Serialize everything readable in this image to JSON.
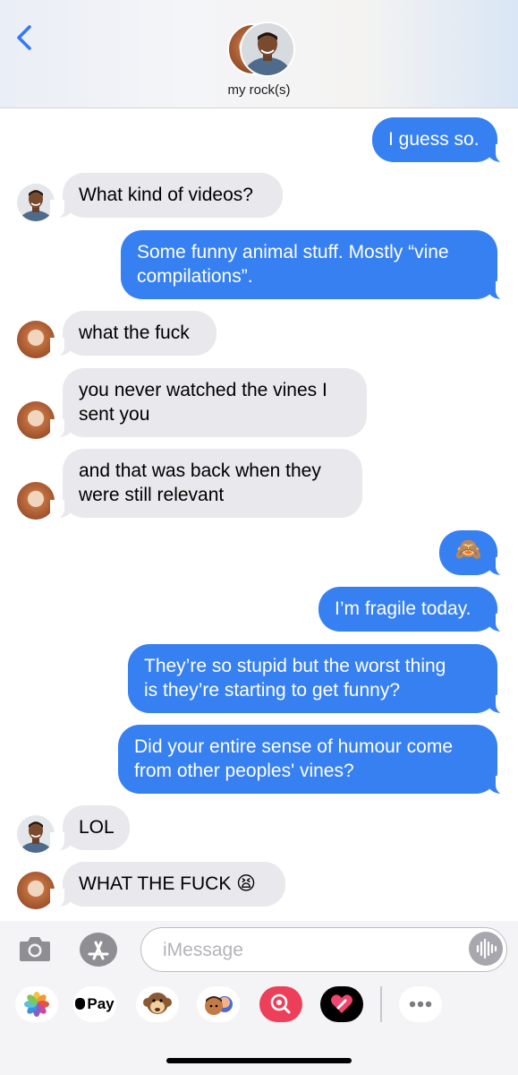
{
  "header": {
    "contact_name": "my rock(s)",
    "back_icon": "chevron-left-icon"
  },
  "messages": [
    {
      "from": "me",
      "text": "I guess so."
    },
    {
      "from": "man",
      "text": "What kind of videos?"
    },
    {
      "from": "me",
      "text": "Some funny animal stuff. Mostly “vine\ncompilations”."
    },
    {
      "from": "woman",
      "text": "what the fuck"
    },
    {
      "from": "woman",
      "text": "you never watched the vines I\nsent you"
    },
    {
      "from": "woman",
      "text": "and that was back when they\nwere still relevant"
    },
    {
      "from": "me",
      "text": "🙈"
    },
    {
      "from": "me",
      "text": "I’m fragile today."
    },
    {
      "from": "me",
      "text": "They’re so stupid but the worst thing\nis they’re starting to get funny?"
    },
    {
      "from": "me",
      "text": "Did your entire sense of humour come\nfrom other peoples' vines?"
    },
    {
      "from": "man",
      "text": "LOL"
    },
    {
      "from": "woman",
      "text": "WHAT THE FUCK 😫"
    }
  ],
  "input": {
    "placeholder": "iMessage",
    "value": ""
  },
  "app_drawer": {
    "apple_pay_label": "Pay",
    "items": [
      "photos-app-icon",
      "apple-pay-icon",
      "animoji-monkey-icon",
      "memoji-stickers-icon",
      "images-search-icon",
      "digital-touch-icon",
      "more-apps-icon"
    ]
  },
  "colors": {
    "sent_bubble": "#3680f1",
    "received_bubble": "#e8e8ed",
    "ios_blue": "#3478f6"
  }
}
